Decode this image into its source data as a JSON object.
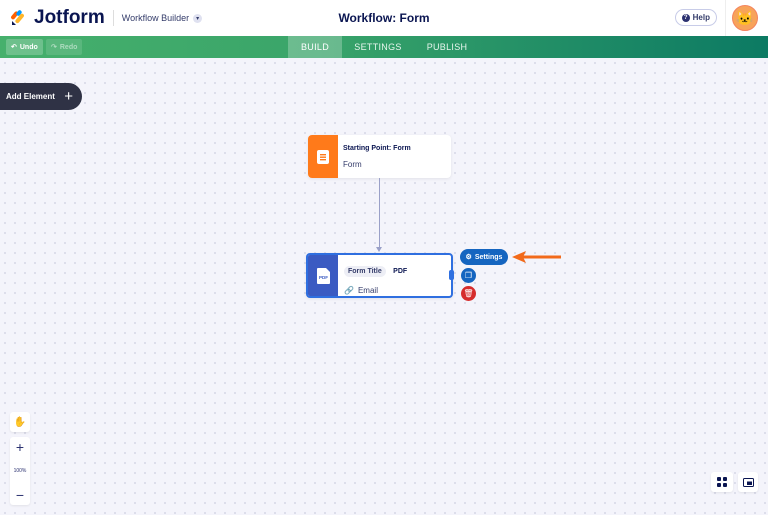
{
  "header": {
    "logo_text": "Jotform",
    "app_menu": "Workflow Builder",
    "title": "Workflow: Form",
    "help_label": "Help"
  },
  "toolbar": {
    "undo_label": "Undo",
    "redo_label": "Redo",
    "tabs": [
      {
        "label": "BUILD",
        "active": true
      },
      {
        "label": "SETTINGS",
        "active": false
      },
      {
        "label": "PUBLISH",
        "active": false
      }
    ]
  },
  "canvas": {
    "add_element_label": "Add Element",
    "start_node": {
      "title": "Starting Point: Form",
      "subtitle": "Form"
    },
    "pdf_node": {
      "icon_text": "PDF",
      "chip": "Form Title",
      "type": "PDF",
      "action": "Email"
    },
    "settings_label": "Settings",
    "zoom_level": "100%"
  },
  "colors": {
    "accent_orange": "#ff7a1a",
    "accent_blue": "#1565c0",
    "delete_red": "#d62d2d",
    "toolbar_green": "#3aa56a"
  }
}
